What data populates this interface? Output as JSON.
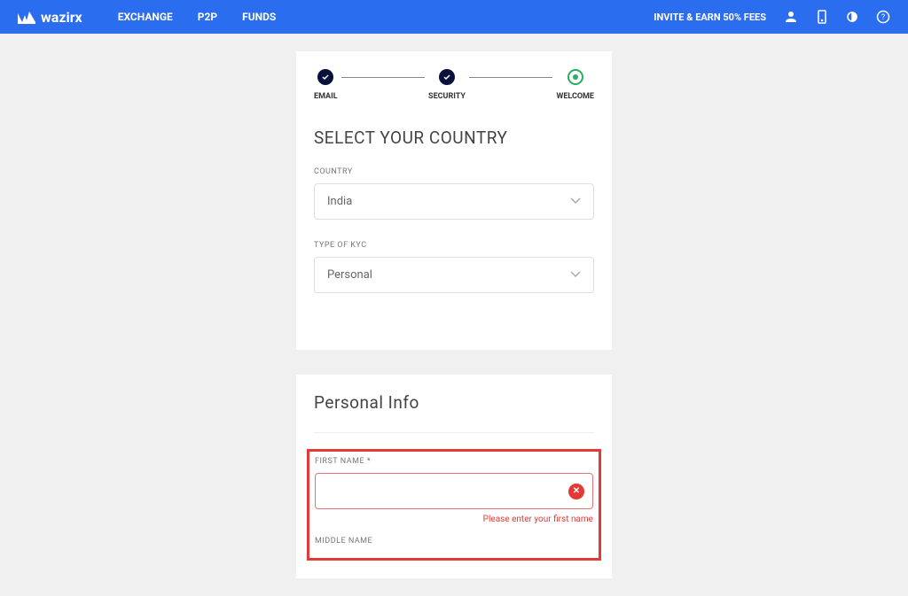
{
  "header": {
    "brand": "wazirx",
    "nav": {
      "exchange": "EXCHANGE",
      "p2p": "P2P",
      "funds": "FUNDS"
    },
    "invite": "INVITE & EARN 50% FEES"
  },
  "stepper": {
    "step1": "EMAIL",
    "step2": "SECURITY",
    "step3": "WELCOME"
  },
  "country_section": {
    "title": "SELECT YOUR COUNTRY",
    "country_label": "COUNTRY",
    "country_value": "India",
    "kyc_label": "TYPE OF KYC",
    "kyc_value": "Personal"
  },
  "personal_section": {
    "title": "Personal Info",
    "first_name_label": "FIRST NAME *",
    "first_name_value": "",
    "first_name_error": "Please enter your first name",
    "middle_name_label": "MIDDLE NAME"
  }
}
